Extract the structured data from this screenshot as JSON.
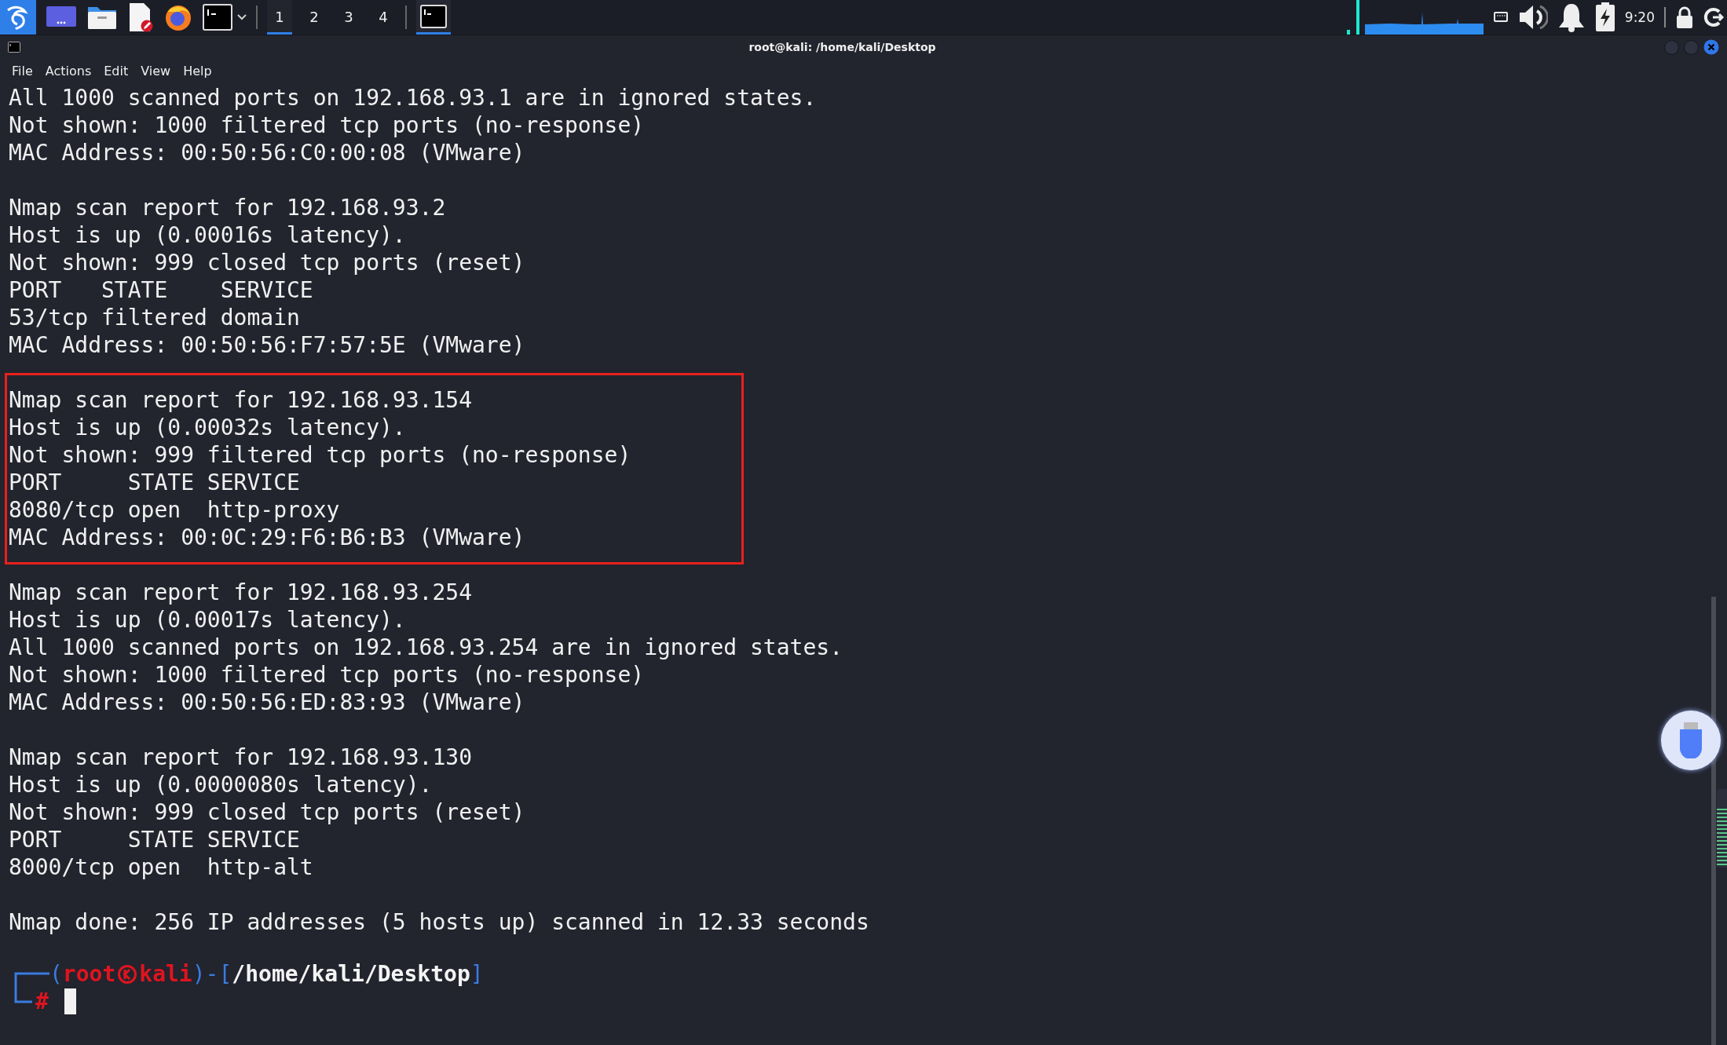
{
  "taskbar": {
    "launchers": [
      {
        "kind": "kali-menu"
      },
      {
        "kind": "desktop"
      },
      {
        "kind": "files"
      },
      {
        "kind": "editor"
      },
      {
        "kind": "browser"
      },
      {
        "kind": "terminal"
      }
    ],
    "workspaces": [
      {
        "label": "1",
        "selected": true
      },
      {
        "label": "2",
        "selected": false
      },
      {
        "label": "3",
        "selected": false
      },
      {
        "label": "4",
        "selected": false
      }
    ],
    "tasks": [
      {
        "kind": "terminal",
        "selected": true
      }
    ],
    "clock": "9:20"
  },
  "window": {
    "title": "root@kali: /home/kali/Desktop"
  },
  "menu": [
    "File",
    "Actions",
    "Edit",
    "View",
    "Help"
  ],
  "terminal": {
    "blocks": [
      {
        "highlighted": false,
        "lines": [
          "All 1000 scanned ports on 192.168.93.1 are in ignored states.",
          "Not shown: 1000 filtered tcp ports (no-response)",
          "MAC Address: 00:50:56:C0:00:08 (VMware)"
        ]
      },
      {
        "highlighted": false,
        "lines": [
          "Nmap scan report for 192.168.93.2",
          "Host is up (0.00016s latency).",
          "Not shown: 999 closed tcp ports (reset)",
          "PORT   STATE    SERVICE",
          "53/tcp filtered domain",
          "MAC Address: 00:50:56:F7:57:5E (VMware)"
        ]
      },
      {
        "highlighted": true,
        "lines": [
          "Nmap scan report for 192.168.93.154",
          "Host is up (0.00032s latency).",
          "Not shown: 999 filtered tcp ports (no-response)",
          "PORT     STATE SERVICE",
          "8080/tcp open  http-proxy",
          "MAC Address: 00:0C:29:F6:B6:B3 (VMware)"
        ]
      },
      {
        "highlighted": false,
        "lines": [
          "Nmap scan report for 192.168.93.254",
          "Host is up (0.00017s latency).",
          "All 1000 scanned ports on 192.168.93.254 are in ignored states.",
          "Not shown: 1000 filtered tcp ports (no-response)",
          "MAC Address: 00:50:56:ED:83:93 (VMware)"
        ]
      },
      {
        "highlighted": false,
        "lines": [
          "Nmap scan report for 192.168.93.130",
          "Host is up (0.0000080s latency).",
          "Not shown: 999 closed tcp ports (reset)",
          "PORT     STATE SERVICE",
          "8000/tcp open  http-alt"
        ]
      },
      {
        "highlighted": false,
        "lines": [
          "Nmap done: 256 IP addresses (5 hosts up) scanned in 12.33 seconds"
        ]
      }
    ],
    "prompt": {
      "open": "(",
      "user": "root",
      "host": "kali",
      "middle": ")-[",
      "path": "/home/kali/Desktop",
      "close": "]",
      "mark": "#"
    }
  },
  "volume_meter": {
    "level": 0.75
  }
}
